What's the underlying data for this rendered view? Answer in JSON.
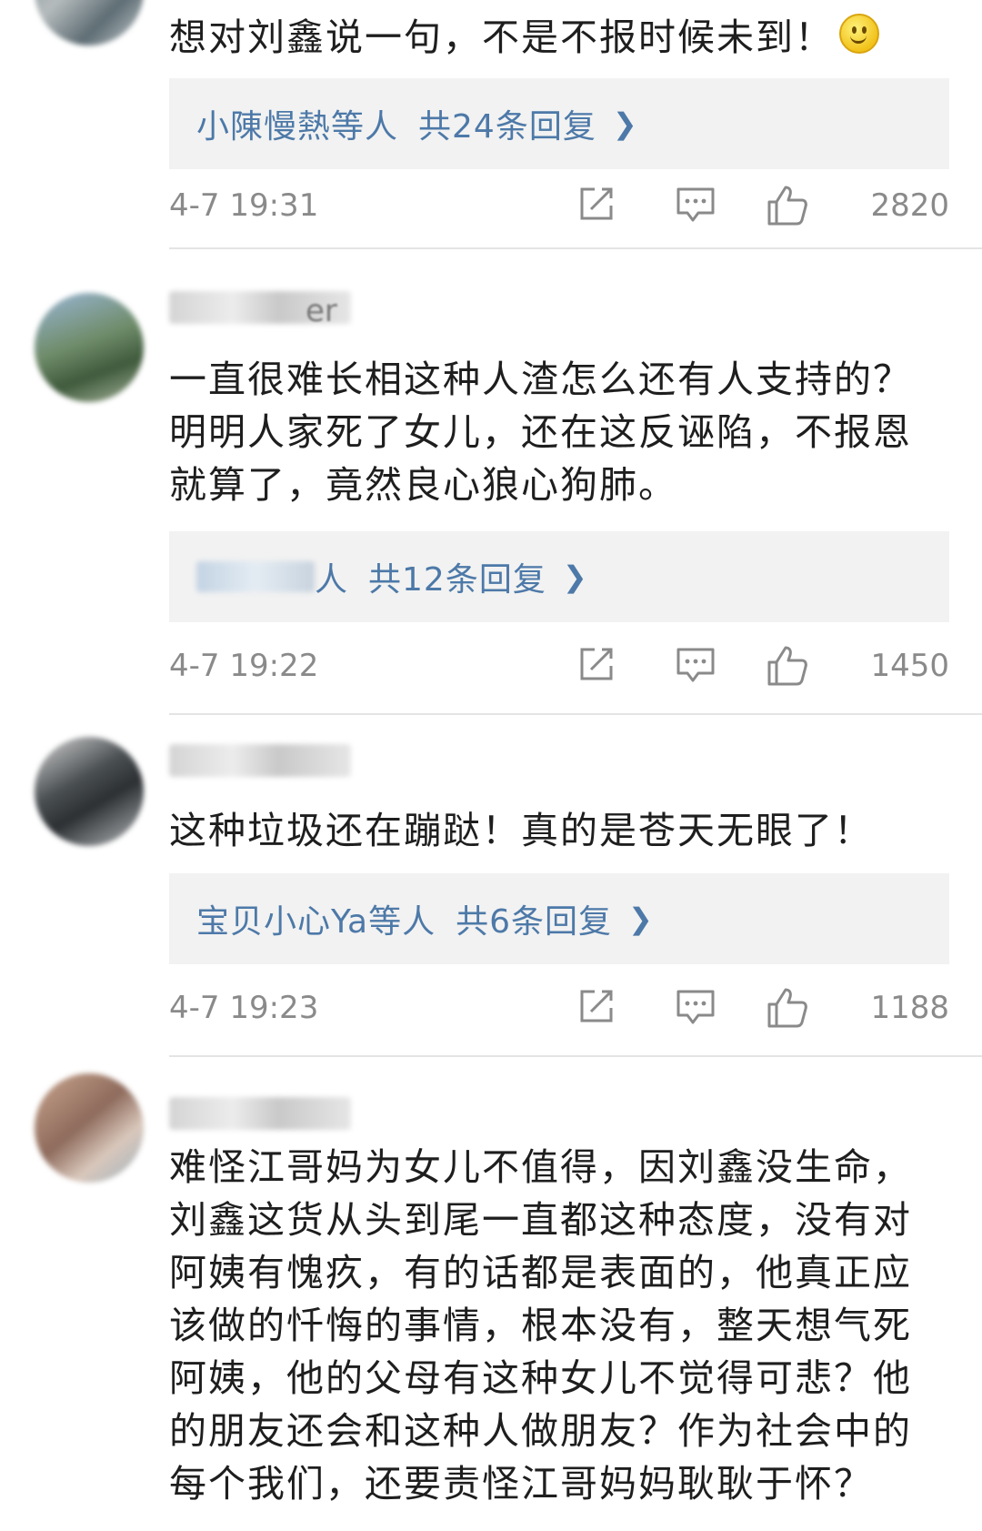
{
  "comments": [
    {
      "text": "想对刘鑫说一句，不是不报时候未到！",
      "reply_names": "小陳慢熱等人",
      "reply_count": "共24条回复",
      "timestamp": "4-7 19:31",
      "likes": "2820"
    },
    {
      "username_visible": "er",
      "text": "一直很难长相这种人渣怎么还有人支持的？明明人家死了女儿，还在这反诬陷，不报恩就算了，竟然良心狼心狗肺。",
      "reply_names": "人",
      "reply_count": "共12条回复",
      "timestamp": "4-7 19:22",
      "likes": "1450"
    },
    {
      "text": "这种垃圾还在蹦跶！真的是苍天无眼了！",
      "reply_names": "宝贝小心Ya等人",
      "reply_count": "共6条回复",
      "timestamp": "4-7 19:23",
      "likes": "1188"
    },
    {
      "text": "难怪江哥妈为女儿不值得，因刘鑫没生命，刘鑫这货从头到尾一直都这种态度，没有对阿姨有愧疚，有的话都是表面的，他真正应该做的忏悔的事情，根本没有，整天想气死阿姨，他的父母有这种女儿不觉得可悲？他的朋友还会和这种人做朋友？作为社会中的每个我们，还要责怪江哥妈妈耿耿于怀？"
    }
  ],
  "icons": {
    "share": "share-icon",
    "comment": "comment-icon",
    "like": "thumbs-up-icon",
    "chevron": "chevron-right-icon",
    "emoji": "smile-emoji-icon"
  },
  "colors": {
    "link": "#4d79a8",
    "meta": "#8a8a8a",
    "reply_bg": "#f2f2f2"
  }
}
